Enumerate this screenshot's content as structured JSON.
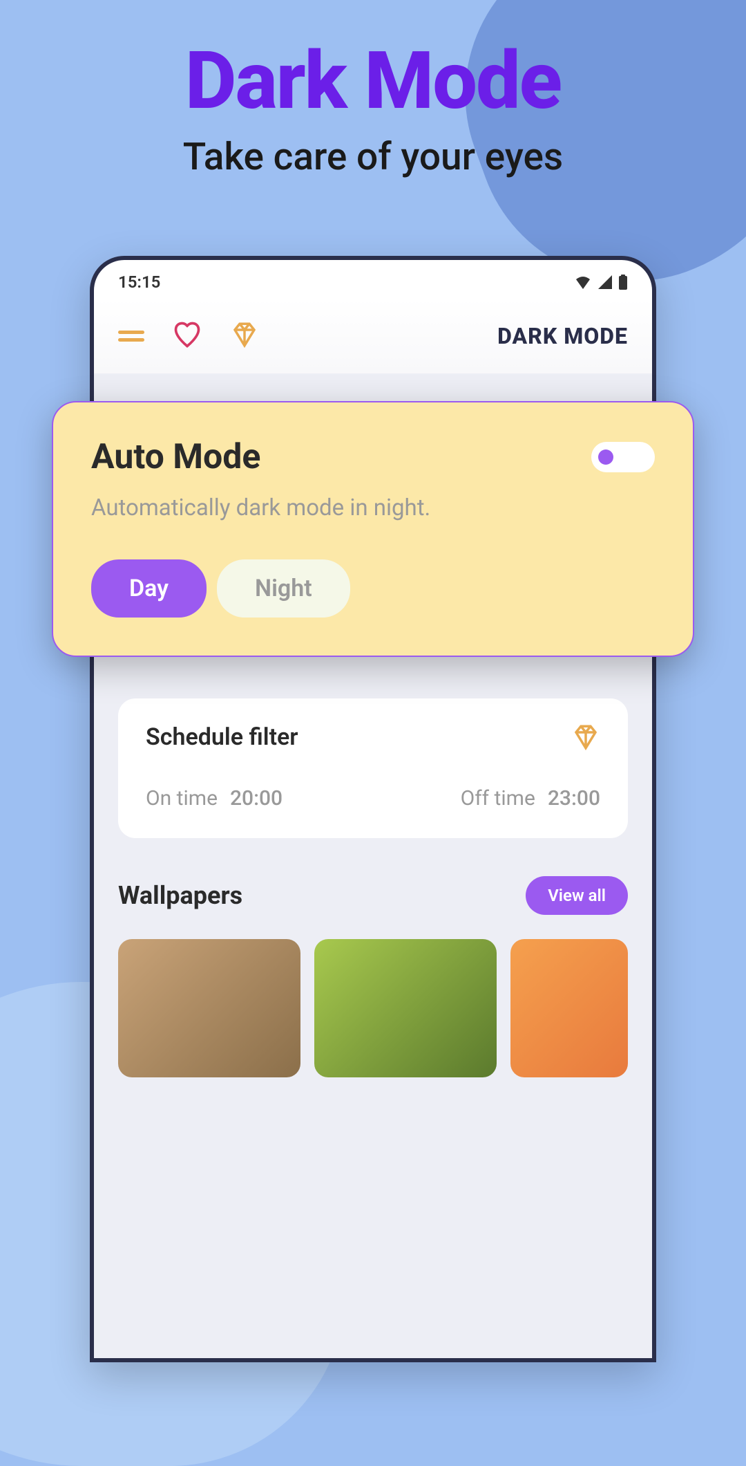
{
  "hero": {
    "title": "Dark Mode",
    "subtitle": "Take care of your eyes"
  },
  "statusBar": {
    "time": "15:15"
  },
  "topBar": {
    "title": "DARK MODE"
  },
  "autoMode": {
    "title": "Auto Mode",
    "description": "Automatically dark mode in night.",
    "dayLabel": "Day",
    "nightLabel": "Night"
  },
  "schedule": {
    "title": "Schedule filter",
    "onTimeLabel": "On time",
    "onTimeValue": "20:00",
    "offTimeLabel": "Off time",
    "offTimeValue": "23:00"
  },
  "wallpapers": {
    "title": "Wallpapers",
    "viewAllLabel": "View all"
  }
}
